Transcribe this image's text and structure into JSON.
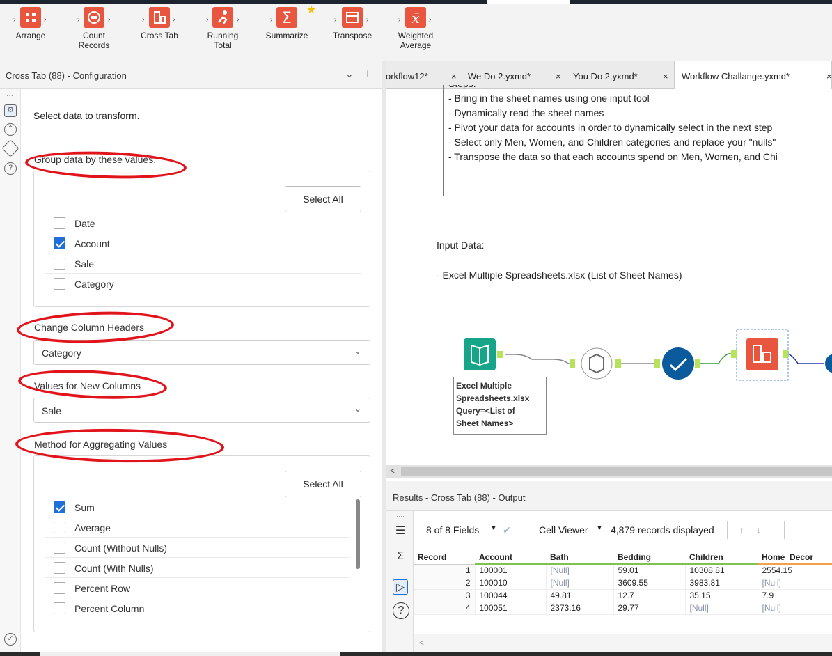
{
  "ribbon": {
    "tools": [
      {
        "label": "Arrange",
        "icon": "arrange-icon"
      },
      {
        "label": "Count\nRecords",
        "icon": "count-records-icon"
      },
      {
        "label": "Cross Tab",
        "icon": "cross-tab-icon"
      },
      {
        "label": "Running\nTotal",
        "icon": "running-total-icon"
      },
      {
        "label": "Summarize",
        "icon": "summarize-icon"
      },
      {
        "label": "Transpose",
        "icon": "transpose-icon"
      },
      {
        "label": "Weighted\nAverage",
        "icon": "weighted-average-icon"
      }
    ]
  },
  "config": {
    "title": "Cross Tab (88) - Configuration",
    "intro": "Select data to transform.",
    "group_title": "Group data by these values:",
    "select_all": "Select All",
    "group_fields": [
      {
        "label": "Date",
        "checked": false
      },
      {
        "label": "Account",
        "checked": true
      },
      {
        "label": "Sale",
        "checked": false
      },
      {
        "label": "Category",
        "checked": false
      }
    ],
    "headers_title": "Change Column Headers",
    "headers_value": "Category",
    "values_title": "Values for New Columns",
    "values_value": "Sale",
    "method_title": "Method for Aggregating Values",
    "methods": [
      {
        "label": "Sum",
        "checked": true
      },
      {
        "label": "Average",
        "checked": false
      },
      {
        "label": "Count (Without Nulls)",
        "checked": false
      },
      {
        "label": "Count (With Nulls)",
        "checked": false
      },
      {
        "label": "Percent Row",
        "checked": false
      },
      {
        "label": "Percent Column",
        "checked": false
      }
    ]
  },
  "tabs": [
    {
      "label": "orkflow12*",
      "close": "×"
    },
    {
      "label": "We Do 2.yxmd*",
      "close": "×"
    },
    {
      "label": "You Do 2.yxmd*",
      "close": "×"
    },
    {
      "label": "Workflow Challange.yxmd*",
      "close": "×"
    }
  ],
  "canvas": {
    "steps_head": "Steps:",
    "steps": [
      "- Bring in the sheet names using one input tool",
      "- Dynamically read the sheet names",
      "- Pivot your data for accounts in order to dynamically select in the next step",
      "- Select only Men, Women, and Children categories and replace your \"nulls\"",
      "- Transpose the data so that each accounts spend on Men, Women, and Chi"
    ],
    "input_heading": "Input Data:",
    "input_file": "- Excel Multiple Spreadsheets.xlsx (List of Sheet Names)",
    "tool_annotation": "Excel Multiple\nSpreadsheets.xlsx\nQuery=<List of\nSheet Names>"
  },
  "results": {
    "title": "Results - Cross Tab (88) - Output",
    "fields": "8 of 8 Fields",
    "cell_viewer": "Cell Viewer",
    "records": "4,879 records displayed",
    "columns": [
      "Record",
      "Account",
      "Bath",
      "Bedding",
      "Children",
      "Home_Decor"
    ],
    "rows": [
      [
        "1",
        "100001",
        "[Null]",
        "59.01",
        "10308.81",
        "2554.15"
      ],
      [
        "2",
        "100010",
        "[Null]",
        "3609.55",
        "3983.81",
        "[Null]"
      ],
      [
        "3",
        "100044",
        "49.81",
        "12.7",
        "35.15",
        "7.9"
      ],
      [
        "4",
        "100051",
        "2373.16",
        "29.77",
        "[Null]",
        "[Null]"
      ]
    ]
  },
  "colors": {
    "accent": "#1e6fd9",
    "tool": "#e9563f",
    "annotation": "#e1141b"
  }
}
